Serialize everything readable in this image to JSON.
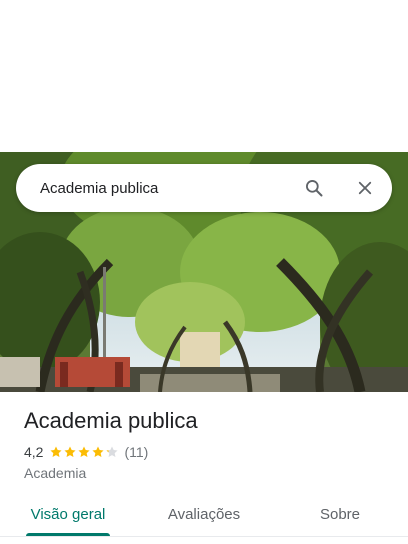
{
  "search": {
    "query": "Academia publica",
    "search_icon": "search-icon",
    "close_icon": "close-icon"
  },
  "hero": {
    "description_icon": "place-photo"
  },
  "place": {
    "title": "Academia publica",
    "rating": "4,2",
    "rating_fraction": 0.84,
    "stars_total": 5,
    "review_count": "(11)",
    "category": "Academia"
  },
  "tabs": [
    {
      "label": "Visão geral",
      "active": true
    },
    {
      "label": "Avaliações",
      "active": false
    },
    {
      "label": "Sobre",
      "active": false
    }
  ],
  "colors": {
    "accent": "#00796b",
    "star": "#fbbc04",
    "star_empty": "#dadce0",
    "text_primary": "#202124",
    "text_secondary": "#70757a"
  }
}
